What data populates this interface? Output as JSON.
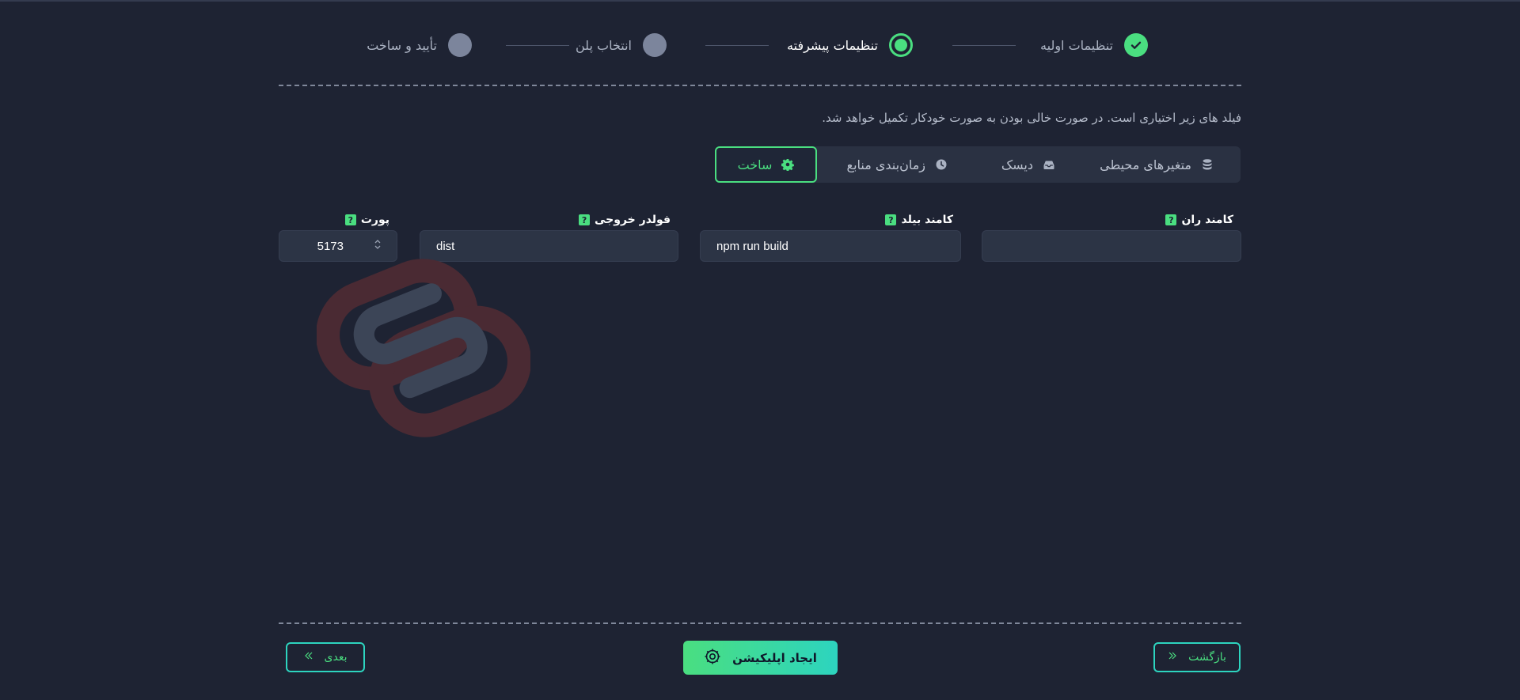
{
  "stepper": {
    "steps": [
      {
        "label": "تنظیمات اولیه",
        "state": "done"
      },
      {
        "label": "تنظیمات پیشرفته",
        "state": "active"
      },
      {
        "label": "انتخاب پلن",
        "state": "todo"
      },
      {
        "label": "تأیید و ساخت",
        "state": "todo"
      }
    ]
  },
  "hint": "فیلد های زیر اختیاری است. در صورت خالی بودن به صورت خودکار تکمیل خواهد شد.",
  "tabs": [
    {
      "label": "متغیرهای محیطی",
      "icon": "database-icon"
    },
    {
      "label": "دیسک",
      "icon": "inbox-icon"
    },
    {
      "label": "زمان‌بندی منابع",
      "icon": "clock-icon"
    },
    {
      "label": "ساخت",
      "icon": "gear-icon",
      "selected": true
    }
  ],
  "fields": {
    "run_command": {
      "label": "کامند ران",
      "value": ""
    },
    "build_command": {
      "label": "کامند بیلد",
      "value": "npm run build"
    },
    "output_folder": {
      "label": "فولدر خروجی",
      "value": "dist"
    },
    "port": {
      "label": "پورت",
      "value": "5173"
    }
  },
  "help_glyph": "?",
  "buttons": {
    "back": "بازگشت",
    "create": "ایجاد اپلیکیشن",
    "next": "بعدی"
  },
  "colors": {
    "background": "#1e2333",
    "accent": "#4ade80",
    "accent_teal": "#2dd4bf",
    "panel": "#2a3142"
  }
}
